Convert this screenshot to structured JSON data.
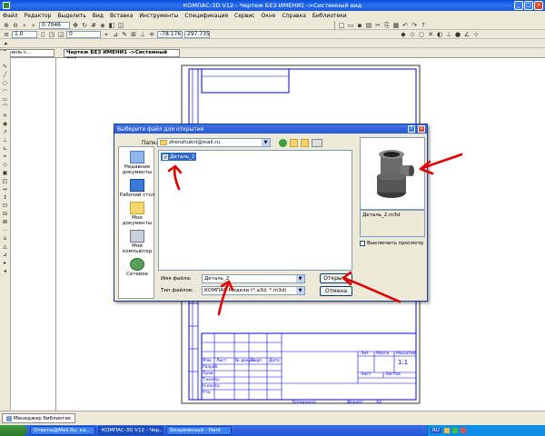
{
  "window": {
    "title": "КОМПАС-3D V12 - Чертеж БЕЗ ИМЕНИ1 ->Системный вид"
  },
  "menu": [
    "Файл",
    "Редактор",
    "Выделить",
    "Вид",
    "Вставка",
    "Инструменты",
    "Спецификация",
    "Сервис",
    "Окно",
    "Справка",
    "Библиотеки"
  ],
  "toolbar": {
    "zoom": "0.7046",
    "line_width": "1.0",
    "layer": "0",
    "coord_x": "-78.176",
    "coord_y": "297.735"
  },
  "tabs": {
    "panel_tab": "Панель с...",
    "doc_tab": "Чертеж БЕЗ ИМЕНИ1 ->Системный вид"
  },
  "dialog": {
    "title": "Выберите файл для открытия",
    "help": "?",
    "close": "×",
    "folder_label": "Папка:",
    "folder_value": "zhenzhuknl@mail.ru",
    "places": [
      "Недавние документы",
      "Рабочий стол",
      "Мои документы",
      "Мой компьютер",
      "Сетевое"
    ],
    "files": [
      "Деталь_2"
    ],
    "filename_label": "Имя файла:",
    "filename_value": "Деталь_2",
    "filetype_label": "Тип файлов:",
    "filetype_value": "КОМПАС-Модели (*.a3d, *.m3d)",
    "open_button": "Открыть",
    "cancel_button": "Отмена",
    "preview_name": "Деталь_2.m3d",
    "disable_preview": "Выключить просмотр"
  },
  "drawing": {
    "stamp_labels": [
      "Лит.",
      "Масса",
      "Масштаб",
      "Изм.",
      "Лист",
      "№ докум.",
      "Подп.",
      "Дата",
      "Разраб.",
      "Пров.",
      "Т.контр.",
      "Н.контр.",
      "Утв.",
      "Лист",
      "Листов",
      "Копировал",
      "Формат",
      "А4"
    ],
    "scale_value": "1:1"
  },
  "statusbar": {
    "library_manager": "Менеджер библиотек"
  },
  "taskbar": {
    "items": [
      "Ответы@Mail.Ru: ка...",
      "КОМПАС-3D V12 - Чер...",
      "Безымянный - Paint"
    ],
    "lang": "RU"
  }
}
